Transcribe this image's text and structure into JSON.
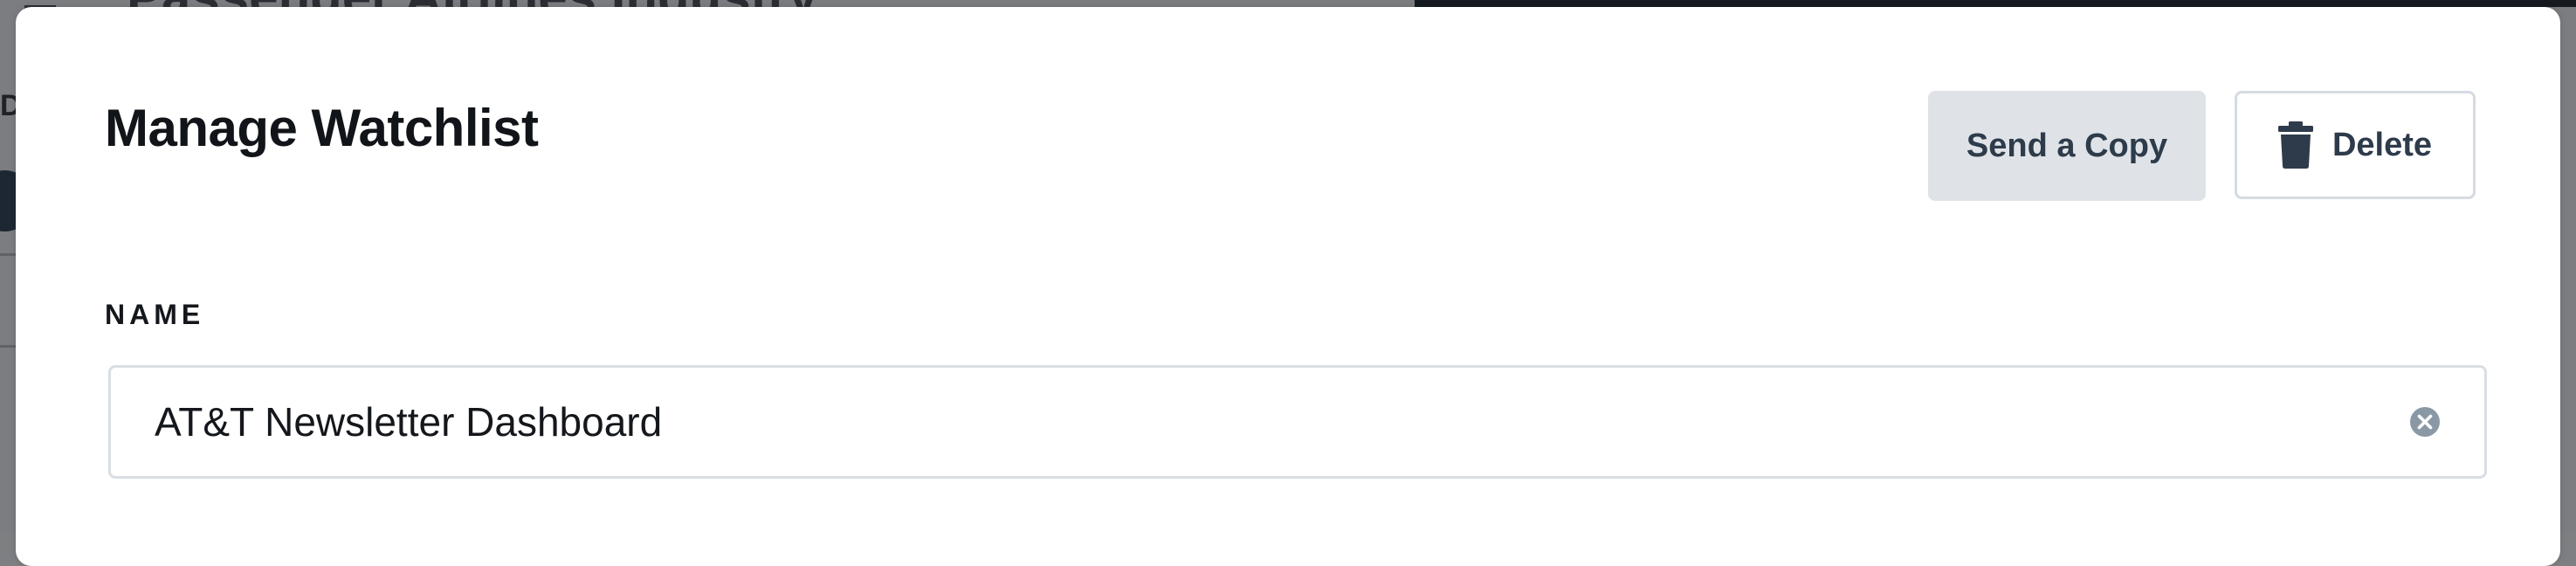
{
  "background": {
    "page_title": "Passenger Airlines Industry",
    "tab_letter": "D"
  },
  "modal": {
    "title": "Manage Watchlist",
    "send_copy_label": "Send a Copy",
    "delete_label": "Delete",
    "delete_icon": "trash-icon",
    "name_label": "NAME",
    "name_value": "AT&T Newsletter Dashboard",
    "clear_icon": "clear-circle-icon"
  },
  "colors": {
    "send_button_bg": "#dfe3e8",
    "button_text": "#2e3b4a",
    "border": "#d5dbe2",
    "clear_icon": "#8a98a6"
  }
}
